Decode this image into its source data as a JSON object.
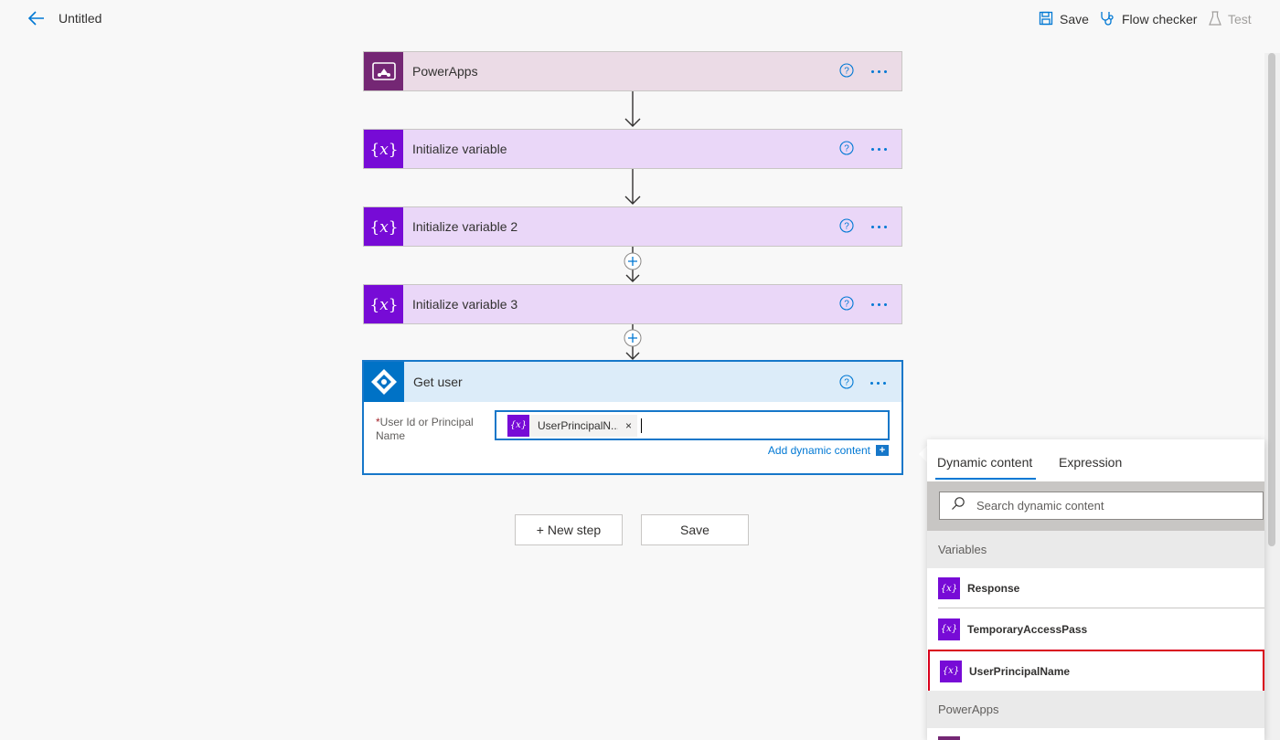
{
  "topbar": {
    "title": "Untitled",
    "save_label": "Save",
    "flow_checker_label": "Flow checker",
    "test_label": "Test"
  },
  "flow": {
    "steps": [
      {
        "name": "PowerApps",
        "kind": "powerapps"
      },
      {
        "name": "Initialize variable",
        "kind": "variable"
      },
      {
        "name": "Initialize variable 2",
        "kind": "variable"
      },
      {
        "name": "Initialize variable 3",
        "kind": "variable"
      }
    ],
    "get_user": {
      "name": "Get user",
      "field_required_mark": "*",
      "field_label": "User Id or Principal Name",
      "token_text": "UserPrincipalN...",
      "token_remove": "×",
      "add_dynamic_label": "Add dynamic content"
    },
    "new_step_label": "+ New step",
    "save_label": "Save"
  },
  "dynamic_panel": {
    "tabs": [
      "Dynamic content",
      "Expression"
    ],
    "active_tab": "Dynamic content",
    "search_placeholder": "Search dynamic content",
    "sections": [
      {
        "title": "Variables",
        "items": [
          "Response",
          "TemporaryAccessPass",
          "UserPrincipalName"
        ]
      },
      {
        "title": "PowerApps",
        "items": []
      }
    ],
    "highlighted_item": "UserPrincipalName"
  },
  "colors": {
    "accent": "#0078d4",
    "variable_icon": "#770bd6",
    "powerapps_icon": "#742774",
    "highlight_border": "#d9001b"
  }
}
